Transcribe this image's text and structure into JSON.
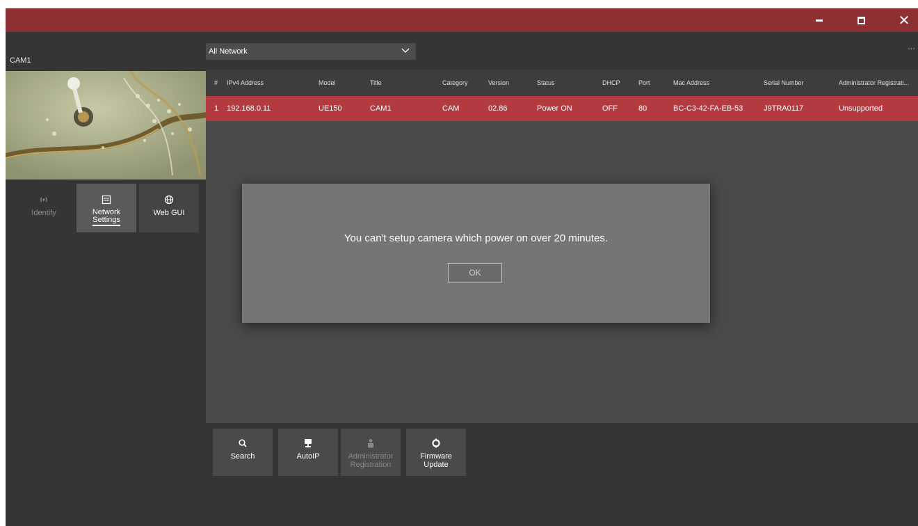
{
  "window": {
    "minimize_icon": "minimize-icon",
    "restore_icon": "restore-icon",
    "close_glyph": "✕"
  },
  "left_panel": {
    "camera_name": "CAM1",
    "actions": [
      {
        "label": "Identify",
        "icon": "identify-icon",
        "enabled": false
      },
      {
        "label1": "Network",
        "label2": "Settings",
        "icon": "network-settings-icon",
        "selected": true
      },
      {
        "label": "Web GUI",
        "icon": "globe-icon"
      }
    ]
  },
  "toolbar": {
    "network_filter": "All Network",
    "more": "···"
  },
  "table": {
    "headers": [
      "#",
      "IPv4 Address",
      "Model",
      "Title",
      "Category",
      "Version",
      "Status",
      "DHCP",
      "Port",
      "Mac Address",
      "Serial Number",
      "Administrator Registrati..."
    ],
    "rows": [
      [
        "1",
        "192.168.0.11",
        "UE150",
        "CAM1",
        "CAM",
        "02.86",
        "Power ON",
        "OFF",
        "80",
        "BC-C3-42-FA-EB-53",
        "J9TRA0117",
        "Unsupported"
      ]
    ]
  },
  "bottom_actions": {
    "search": "Search",
    "autoip": "AutoIP",
    "admin_line1": "Administrator",
    "admin_line2": "Registration",
    "firmware_line1": "Firmware",
    "firmware_line2": "Update"
  },
  "dialog": {
    "message": "You can't setup camera which power on over 20 minutes.",
    "ok_label": "OK"
  },
  "colors": {
    "titlebar": "#8e2f33",
    "selected_row": "#b33a3f",
    "background": "#353535"
  }
}
